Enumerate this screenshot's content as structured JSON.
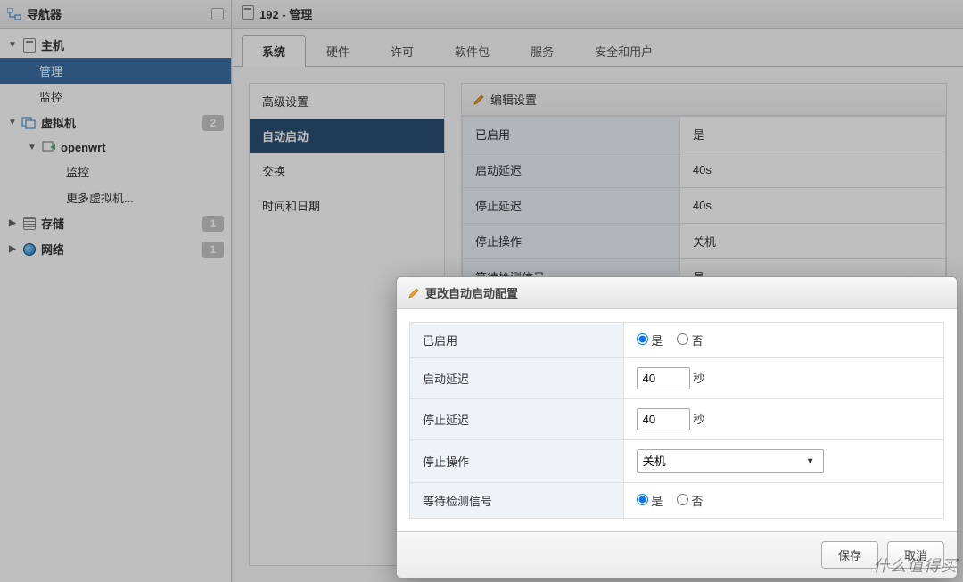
{
  "sidebar": {
    "title": "导航器",
    "host": {
      "label": "主机"
    },
    "host_children": {
      "manage": "管理",
      "monitor": "监控"
    },
    "vm": {
      "label": "虚拟机",
      "badge": "2"
    },
    "vm_children": {
      "openwrt": "openwrt",
      "monitor": "监控",
      "more": "更多虚拟机..."
    },
    "storage": {
      "label": "存储",
      "badge": "1"
    },
    "network": {
      "label": "网络",
      "badge": "1"
    }
  },
  "content": {
    "title": "192 - 管理"
  },
  "tabs": {
    "system": "系统",
    "hardware": "硬件",
    "license": "许可",
    "packages": "软件包",
    "services": "服务",
    "security": "安全和用户"
  },
  "leftmenu": {
    "advanced": "高级设置",
    "autostart": "自动启动",
    "swap": "交换",
    "datetime": "时间和日期"
  },
  "detail": {
    "header": "编辑设置",
    "rows": {
      "enabled": {
        "k": "已启用",
        "v": "是"
      },
      "start_delay": {
        "k": "启动延迟",
        "v": "40s"
      },
      "stop_delay": {
        "k": "停止延迟",
        "v": "40s"
      },
      "stop_action": {
        "k": "停止操作",
        "v": "关机"
      },
      "wait_heartbeat": {
        "k": "等待检测信号",
        "v": "是"
      }
    }
  },
  "modal": {
    "title": "更改自动启动配置",
    "rows": {
      "enabled": "已启用",
      "start_delay": "启动延迟",
      "stop_delay": "停止延迟",
      "stop_action": "停止操作",
      "wait_heartbeat": "等待检测信号"
    },
    "options": {
      "yes": "是",
      "no": "否"
    },
    "unit_sec": "秒",
    "values": {
      "start_delay": "40",
      "stop_delay": "40",
      "stop_action": "关机"
    },
    "buttons": {
      "save": "保存",
      "cancel": "取消"
    }
  },
  "watermark": "什么值得买"
}
